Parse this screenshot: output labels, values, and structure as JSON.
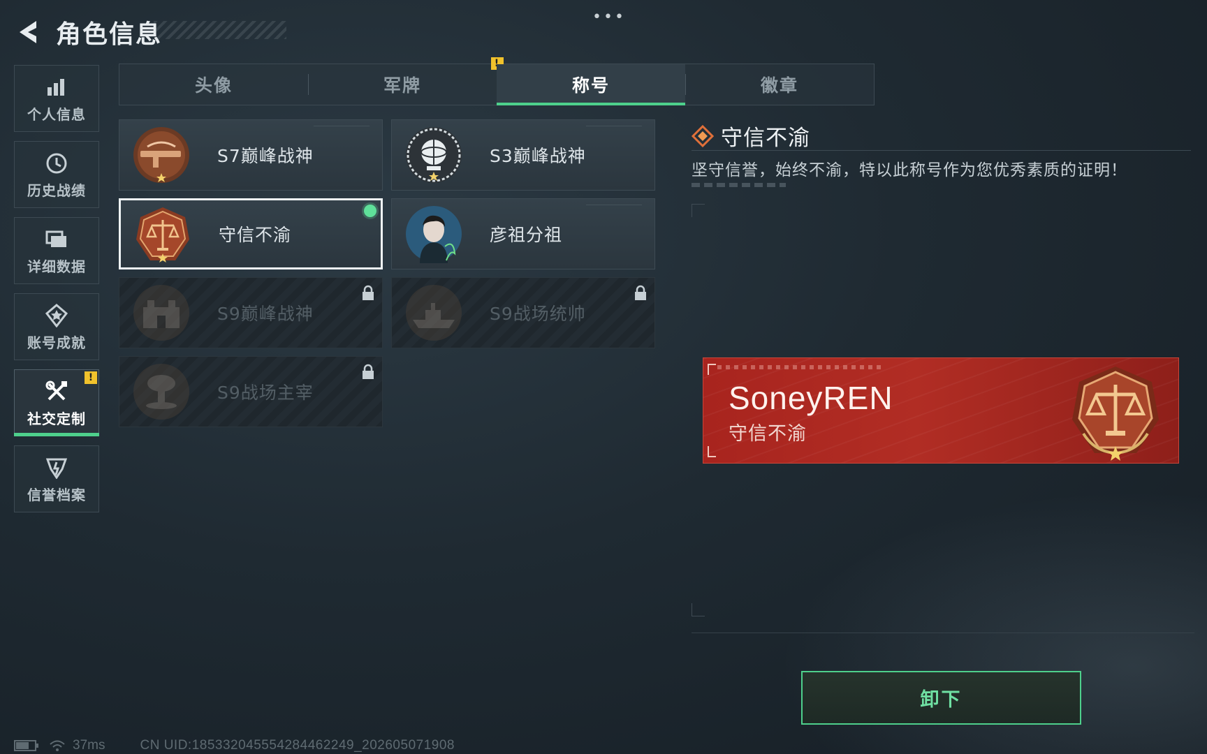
{
  "header": {
    "title": "角色信息"
  },
  "topbar": {
    "more": "•••"
  },
  "sidebar": {
    "items": [
      {
        "label": "个人信息",
        "icon": "bar-chart-icon"
      },
      {
        "label": "历史战绩",
        "icon": "history-clock-icon"
      },
      {
        "label": "详细数据",
        "icon": "folder-stack-icon"
      },
      {
        "label": "账号成就",
        "icon": "achievement-medal-icon"
      },
      {
        "label": "社交定制",
        "icon": "tools-icon",
        "active": true,
        "alert": "!"
      },
      {
        "label": "信誉档案",
        "icon": "credit-emblem-icon"
      }
    ]
  },
  "tabs": [
    {
      "label": "头像"
    },
    {
      "label": "军牌",
      "alert": "!"
    },
    {
      "label": "称号",
      "active": true
    },
    {
      "label": "徽章"
    }
  ],
  "titles": [
    {
      "label": "S7巅峰战神",
      "locked": false,
      "emblem": "rifle-emblem-icon"
    },
    {
      "label": "S3巅峰战神",
      "locked": false,
      "emblem": "globe-emblem-icon"
    },
    {
      "label": "守信不渝",
      "locked": false,
      "selected": true,
      "equipped": true,
      "emblem": "scales-emblem-icon"
    },
    {
      "label": "彦祖分祖",
      "locked": false,
      "emblem": "portrait-emblem-icon"
    },
    {
      "label": "S9巅峰战神",
      "locked": true,
      "emblem": "fortress-emblem-icon"
    },
    {
      "label": "S9战场统帅",
      "locked": true,
      "emblem": "warship-emblem-icon"
    },
    {
      "label": "S9战场主宰",
      "locked": true,
      "emblem": "mushroom-cloud-emblem-icon"
    }
  ],
  "detail": {
    "name": "守信不渝",
    "description": "坚守信誉，始终不渝，特以此称号作为您优秀素质的证明！"
  },
  "preview": {
    "player_name": "SoneyREN",
    "title": "守信不渝"
  },
  "actions": {
    "unequip": "卸下"
  },
  "statusbar": {
    "ping": "37ms",
    "uid": "CN UID:1853320455542844622​49_202605071908"
  },
  "colors": {
    "accent": "#4ed08c",
    "plate": "#a8241e",
    "warning": "#f1c22c"
  }
}
